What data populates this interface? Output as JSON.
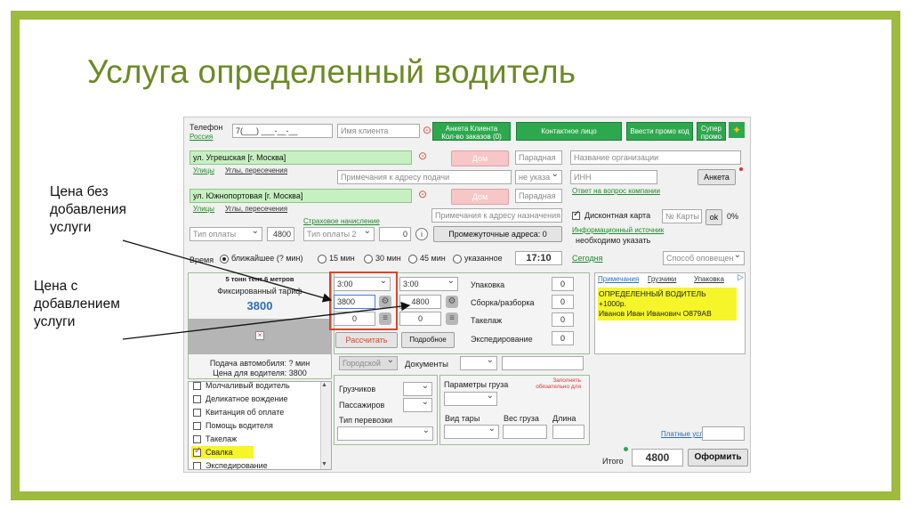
{
  "slide": {
    "title": "Услуга определенный водитель",
    "note_without": "Цена без\nдобавления\nуслуги",
    "note_with": "Цена с\nдобавлением\nуслуги"
  },
  "header": {
    "phone_label": "Телефон",
    "country_link": "Россия",
    "phone_value": "7(___) ___-__-__",
    "client_name_placeholder": "Имя клиента",
    "anketa_client_btn": "Анкета Клиента\nКол-во заказов (0)",
    "contact_person_btn": "Контактное лицо",
    "promo_btn": "Ввести промо код",
    "super_promo_btn": "Супер\nпромо"
  },
  "address1": {
    "value": "ул. Угрешская [г. Москва]",
    "house_placeholder": "Дом",
    "entrance_placeholder": "Парадная",
    "streets_link": "Улицы",
    "corners_link": "Углы, пересечения",
    "notes_placeholder": "Примечания к адресу подачи",
    "unit_select": "не указа"
  },
  "address2": {
    "value": "ул. Южнопортовая [г. Москва]",
    "house_placeholder": "Дом",
    "entrance_placeholder": "Парадная",
    "streets_link": "Улицы",
    "corners_link": "Углы, пересечения",
    "notes_placeholder": "Примечания к адресу назначения"
  },
  "company": {
    "name_placeholder": "Название организации",
    "inn_placeholder": "ИНН",
    "anketa_btn": "Анкета",
    "company_answer_link": "Ответ на вопрос компании",
    "discount_label": "Дисконтная карта",
    "card_placeholder": "№ Карты",
    "ok_btn": "ok",
    "percent": "0%",
    "info_source_link": "Информационный источник",
    "info_source_value": "необходимо указать"
  },
  "payment": {
    "type1": "Тип оплаты",
    "amount1": "4800",
    "insurance_link": "Страховое начисление",
    "type2": "Тип оплаты 2",
    "amount2": "0",
    "intermediate_btn": "Промежуточные адреса: 0"
  },
  "time": {
    "label": "Время",
    "options": [
      "ближайшее (? мин)",
      "15 мин",
      "30 мин",
      "45 мин",
      "указанное"
    ],
    "clock": "17:10",
    "today_link": "Сегодня",
    "notify_select": "Способ оповещен"
  },
  "tariff": {
    "vehicle": "5 тонн тент 6 метров",
    "type": "Фиксированный тариф",
    "price": "3800",
    "delivery": "Подача автомобиля: ? мин",
    "driver_price": "Цена для водителя: 3800"
  },
  "calc": {
    "time_a": "3:00",
    "time_b": "3:00",
    "price_without": "3800",
    "price_with": "4800",
    "zero_a": "0",
    "zero_b": "0",
    "calculate_btn": "Рассчитать",
    "detailed_btn": "Подробное"
  },
  "extras": [
    {
      "label": "Упаковка",
      "value": "0"
    },
    {
      "label": "Сборка/разборка",
      "value": "0"
    },
    {
      "label": "Такелаж",
      "value": "0"
    },
    {
      "label": "Экспедирование",
      "value": "0"
    }
  ],
  "notes_tabs": [
    "Примечания",
    "Грузчики",
    "Упаковка"
  ],
  "notes_text": "ОПРЕДЕЛЕННЫЙ ВОДИТЕЛЬ +1000р.\nИванов Иван Иванович О879АВ",
  "services": [
    {
      "label": "Молчаливый водитель",
      "checked": false
    },
    {
      "label": "Деликатное вождение",
      "checked": false
    },
    {
      "label": "Квитанция об оплате",
      "checked": false
    },
    {
      "label": "Помощь водителя",
      "checked": false
    },
    {
      "label": "Такелаж",
      "checked": false
    },
    {
      "label": "Свалка",
      "checked": true
    },
    {
      "label": "Экспедирование",
      "checked": false
    }
  ],
  "docs": {
    "city_select": "Городской",
    "documents_label": "Документы"
  },
  "cargo": {
    "loaders_label": "Грузчиков",
    "passengers_label": "Пассажиров",
    "transport_type_label": "Тип перевозки",
    "params_label": "Параметры груза",
    "fill_required": "Заполнять\nобязательно для",
    "package_type_label": "Вид тары",
    "weight_label": "Вес груза",
    "length_label": "Длина"
  },
  "footer": {
    "paid_services_link": "Платные услуги",
    "total_label": "Итого",
    "total_value": "4800",
    "submit_btn": "Оформить"
  },
  "colors": {
    "frame": "#9dbb3c",
    "title": "#6c8a25",
    "green_button": "#2ea84e",
    "highlight": "#f5f52a",
    "red_box": "#d9462b"
  }
}
